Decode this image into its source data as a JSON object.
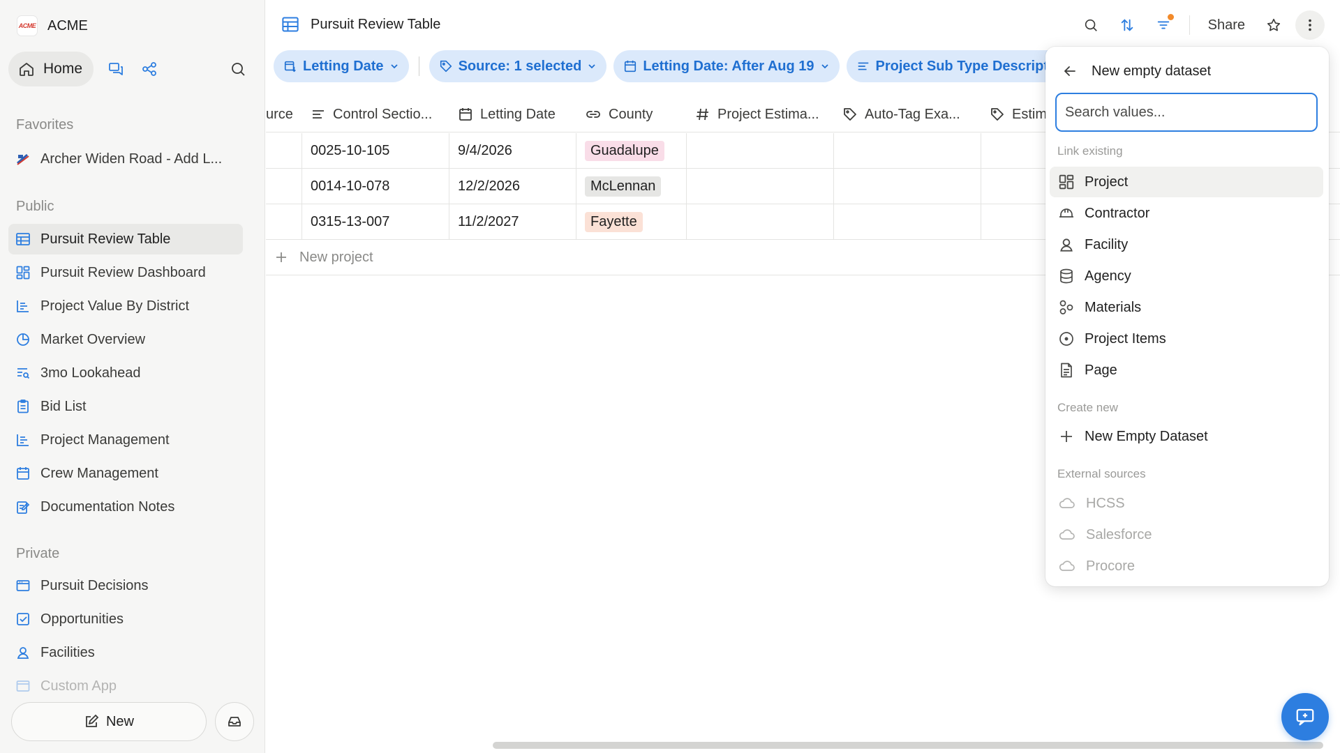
{
  "workspace": {
    "logo_text": "ACME",
    "name": "ACME"
  },
  "nav": {
    "home_label": "Home",
    "favorites_label": "Favorites",
    "favorites": [
      {
        "label": "Archer Widen Road - Add L...",
        "icon": "flag-icon"
      }
    ],
    "public_label": "Public",
    "public_items": [
      {
        "label": "Pursuit Review Table",
        "icon": "table-icon",
        "active": true
      },
      {
        "label": "Pursuit Review Dashboard",
        "icon": "dashboard-icon"
      },
      {
        "label": "Project Value By District",
        "icon": "bar-chart-icon"
      },
      {
        "label": "Market Overview",
        "icon": "pie-chart-icon"
      },
      {
        "label": "3mo Lookahead",
        "icon": "timeline-search-icon"
      },
      {
        "label": "Bid List",
        "icon": "clipboard-icon"
      },
      {
        "label": "Project Management",
        "icon": "bar-chart-icon"
      },
      {
        "label": "Crew Management",
        "icon": "calendar-icon"
      },
      {
        "label": "Documentation Notes",
        "icon": "edit-note-icon"
      }
    ],
    "private_label": "Private",
    "private_items": [
      {
        "label": "Pursuit Decisions",
        "icon": "window-icon"
      },
      {
        "label": "Opportunities",
        "icon": "checkbox-icon"
      },
      {
        "label": "Facilities",
        "icon": "location-person-icon"
      },
      {
        "label": "Custom App",
        "icon": "window-icon"
      }
    ],
    "new_label": "New"
  },
  "header": {
    "title": "Pursuit Review Table",
    "share_label": "Share"
  },
  "filters": [
    {
      "label": "Letting Date",
      "icon": "calendar-sort-icon"
    },
    {
      "label": "Source: 1 selected",
      "icon": "tag-icon"
    },
    {
      "label": "Letting Date: After Aug 19",
      "icon": "calendar-icon"
    },
    {
      "label": "Project Sub Type Description: c",
      "icon": "text-lines-icon"
    }
  ],
  "table": {
    "columns": [
      {
        "label": "urce",
        "icon": ""
      },
      {
        "label": "Control Sectio...",
        "icon": "text-lines-icon"
      },
      {
        "label": "Letting Date",
        "icon": "calendar-icon"
      },
      {
        "label": "County",
        "icon": "link-icon"
      },
      {
        "label": "Project Estima...",
        "icon": "hash-icon"
      },
      {
        "label": "Auto-Tag Exa...",
        "icon": "tag-icon"
      },
      {
        "label": "Estim",
        "icon": "tag-icon"
      }
    ],
    "rows": [
      {
        "control_section": "0025-10-105",
        "letting_date": "9/4/2026",
        "county": "Guadalupe",
        "county_color": "#f9dde8"
      },
      {
        "control_section": "0014-10-078",
        "letting_date": "12/2/2026",
        "county": "McLennan",
        "county_color": "#e6e6e4"
      },
      {
        "control_section": "0315-13-007",
        "letting_date": "11/2/2027",
        "county": "Fayette",
        "county_color": "#fbe1d6"
      }
    ],
    "add_label": "New project"
  },
  "dropdown": {
    "title": "New empty dataset",
    "search_placeholder": "Search values...",
    "link_existing_label": "Link existing",
    "link_items": [
      {
        "label": "Project",
        "icon": "dashboard-icon",
        "highlighted": true
      },
      {
        "label": "Contractor",
        "icon": "hard-hat-icon"
      },
      {
        "label": "Facility",
        "icon": "location-person-icon"
      },
      {
        "label": "Agency",
        "icon": "database-icon"
      },
      {
        "label": "Materials",
        "icon": "shapes-icon"
      },
      {
        "label": "Project Items",
        "icon": "circle-dot-icon"
      },
      {
        "label": "Page",
        "icon": "document-icon"
      }
    ],
    "create_new_label": "Create new",
    "create_items": [
      {
        "label": "New Empty Dataset",
        "icon": "plus-icon"
      }
    ],
    "external_label": "External sources",
    "external_items": [
      {
        "label": "HCSS",
        "icon": "cloud-icon"
      },
      {
        "label": "Salesforce",
        "icon": "cloud-icon"
      },
      {
        "label": "Procore",
        "icon": "cloud-icon"
      }
    ]
  },
  "colors": {
    "accent": "#2d7ee0",
    "chip_bg": "#dbe9fb",
    "chip_text": "#1f6fd1",
    "notification_dot": "#f28a2a"
  }
}
